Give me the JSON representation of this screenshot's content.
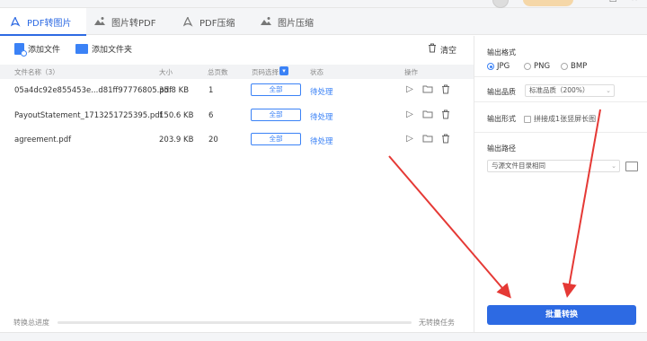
{
  "titlebar": {
    "vip_label": "",
    "win_min": "—",
    "win_max": "□",
    "win_close": "✕"
  },
  "tabs": [
    {
      "label": "PDF转图片",
      "active": true,
      "icon": "pdf-icon"
    },
    {
      "label": "图片转PDF",
      "active": false,
      "icon": "image-to-pdf-icon"
    },
    {
      "label": "PDF压缩",
      "active": false,
      "icon": "compress-icon"
    },
    {
      "label": "图片压缩",
      "active": false,
      "icon": "image-compress-icon"
    }
  ],
  "toolbar": {
    "add_file": "添加文件",
    "add_folder": "添加文件夹",
    "clear": "清空"
  },
  "table": {
    "headers": {
      "name": "文件名称（3）",
      "size": "大小",
      "pages": "总页数",
      "page_select": "页码选择",
      "status": "状态",
      "ops": "操作"
    },
    "rows": [
      {
        "name": "05a4dc92e855453e...d81ff97776805.pdf",
        "size": "35.8 KB",
        "pages": "1",
        "page_select": "全部",
        "status": "待处理"
      },
      {
        "name": "PayoutStatement_1713251725395.pdf",
        "size": "150.6 KB",
        "pages": "6",
        "page_select": "全部",
        "status": "待处理"
      },
      {
        "name": "agreement.pdf",
        "size": "203.9 KB",
        "pages": "20",
        "page_select": "全部",
        "status": "待处理"
      }
    ]
  },
  "progress": {
    "label": "转换总进度",
    "value": 0,
    "status": "无转换任务"
  },
  "settings": {
    "format_label": "输出格式",
    "formats": [
      "JPG",
      "PNG",
      "BMP"
    ],
    "selected_format": "JPG",
    "quality_label": "输出品质",
    "quality_value": "标准品质（200%）",
    "form_label": "输出形式",
    "form_option": "拼接成1张竖屏长图",
    "path_label": "输出路径",
    "path_value": "与源文件目录相同",
    "convert_button": "批量转换"
  },
  "colors": {
    "accent": "#2d6ae3",
    "link": "#3b82f6",
    "annotation": "#e53935"
  }
}
